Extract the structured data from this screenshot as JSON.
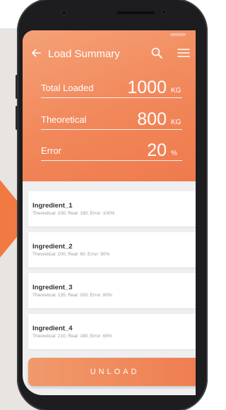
{
  "appbar": {
    "title": "Load Summary",
    "back_icon": "arrow-left-icon",
    "search_icon": "search-icon",
    "menu_icon": "hamburger-menu-icon"
  },
  "metrics": [
    {
      "label": "Total Loaded",
      "value": "1000",
      "unit": "KG"
    },
    {
      "label": "Theoretical",
      "value": "800",
      "unit": "KG"
    },
    {
      "label": "Error",
      "value": "20",
      "unit": "%"
    }
  ],
  "ingredients": [
    {
      "name": "Ingredient_1",
      "detail": "Theoretical: 100; Real: 180; Error: 100%"
    },
    {
      "name": "Ingredient_2",
      "detail": "Theoretical: 200; Real: 60; Error: 90%"
    },
    {
      "name": "Ingredient_3",
      "detail": "Theoretical: 135; Real: 200; Error: 80%"
    },
    {
      "name": "Ingredient_4",
      "detail": "Theoretical: 210; Real: 180; Error: 65%"
    }
  ],
  "actions": {
    "unload_label": "UNLOAD"
  },
  "colors": {
    "accent": "#ef7d50",
    "header_light": "#f5a176",
    "background": "#e7e4e2"
  }
}
